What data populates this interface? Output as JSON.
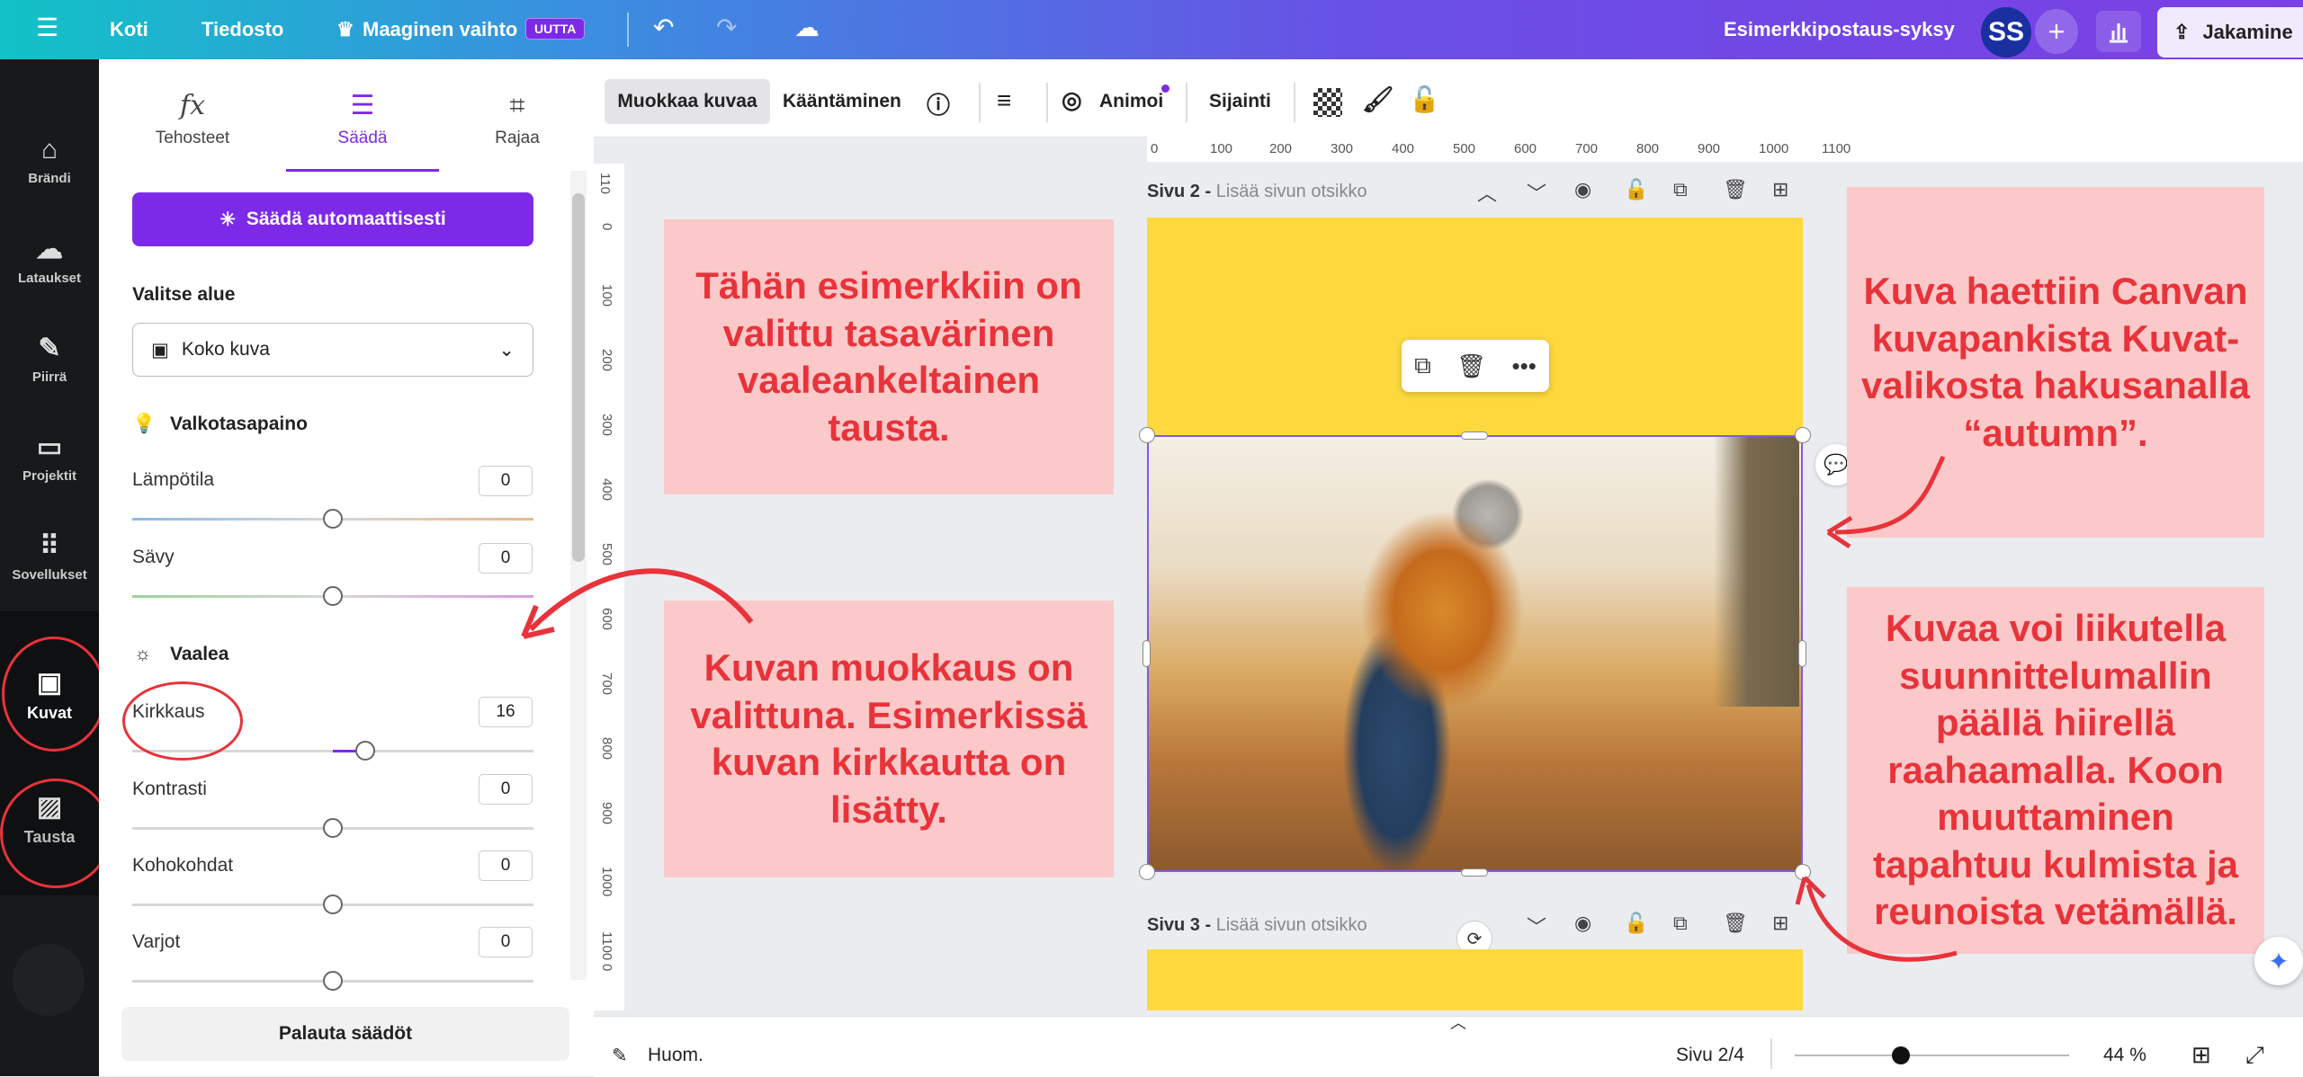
{
  "topbar": {
    "menu_icon": "hamburger-icon",
    "home": "Koti",
    "file": "Tiedosto",
    "magic_switch": "Maaginen vaihto",
    "magic_badge": "UUTTA",
    "design_title": "Esimerkkipostaus-syksy",
    "avatar_initials": "SS",
    "share_label": "Jakamine"
  },
  "rail": {
    "items": [
      {
        "label": "Brändi",
        "icon": "brand-icon"
      },
      {
        "label": "Lataukset",
        "icon": "upload-cloud-icon"
      },
      {
        "label": "Piirrä",
        "icon": "draw-icon"
      },
      {
        "label": "Projektit",
        "icon": "folder-icon"
      },
      {
        "label": "Sovellukset",
        "icon": "apps-grid-icon"
      },
      {
        "label": "Kuvat",
        "icon": "image-icon"
      },
      {
        "label": "Tausta",
        "icon": "background-icon"
      }
    ]
  },
  "panel": {
    "tabs": [
      {
        "label": "Tehosteet",
        "icon": "fx-icon"
      },
      {
        "label": "Säädä",
        "icon": "sliders-icon"
      },
      {
        "label": "Rajaa",
        "icon": "crop-icon"
      }
    ],
    "auto_adjust": "Säädä automaattisesti",
    "area_title": "Valitse alue",
    "area_value": "Koko kuva",
    "white_balance": "Valkotasapaino",
    "light": "Vaalea",
    "sliders": [
      {
        "label": "Lämpötila",
        "value": "0"
      },
      {
        "label": "Sävy",
        "value": "0"
      },
      {
        "label": "Kirkkaus",
        "value": "16"
      },
      {
        "label": "Kontrasti",
        "value": "0"
      },
      {
        "label": "Kohokohdat",
        "value": "0"
      },
      {
        "label": "Varjot",
        "value": "0"
      }
    ],
    "reset": "Palauta säädöt"
  },
  "toolbar": {
    "edit_image": "Muokkaa kuvaa",
    "flip": "Kääntäminen",
    "animate": "Animoi",
    "position": "Sijainti"
  },
  "ruler": {
    "h_ticks": [
      "0",
      "100",
      "200",
      "300",
      "400",
      "500",
      "600",
      "700",
      "800",
      "900",
      "1000",
      "1100"
    ],
    "v_ticks": [
      "110",
      "0",
      "100",
      "200",
      "300",
      "400",
      "500",
      "600",
      "700",
      "800",
      "900",
      "1000",
      "1100",
      "0"
    ]
  },
  "canvas": {
    "page2_num": "Sivu 2 -",
    "page2_sub": "Lisää sivun otsikko",
    "page3_num": "Sivu 3 -",
    "page3_sub": "Lisää sivun otsikko",
    "page_bg_color": "#fdd93e"
  },
  "notes": {
    "note1": "Tähän esimerkkiin on valittu tasavärinen vaaleankeltainen tausta.",
    "note2": "Kuvan muokkaus on valittuna. Esimerkissä kuvan kirkkautta on lisätty.",
    "note3": "Kuva haettiin Canvan kuvapankista Kuvat-valikosta hakusanalla “autumn”.",
    "note4": "Kuvaa voi liikutella suunnittelumallin päällä hiirellä raahaamalla. Koon muuttaminen tapahtuu kulmista ja reunoista vetämällä."
  },
  "bottombar": {
    "notes": "Huom.",
    "page_counter": "Sivu 2/4",
    "zoom": "44 %",
    "zoom_level": 0.44
  }
}
